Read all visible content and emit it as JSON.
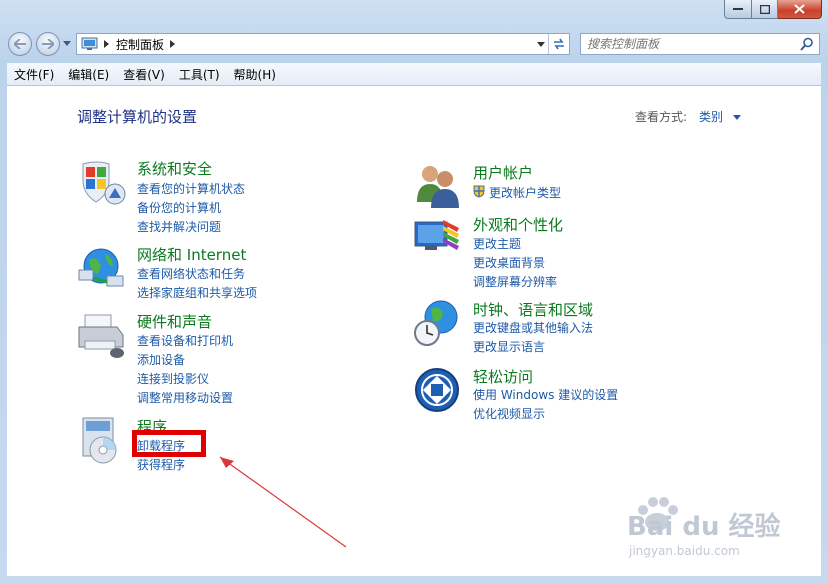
{
  "address": {
    "crumb": "控制面板"
  },
  "search": {
    "placeholder": "搜索控制面板"
  },
  "menu": [
    "文件(F)",
    "编辑(E)",
    "查看(V)",
    "工具(T)",
    "帮助(H)"
  ],
  "content": {
    "title": "调整计算机的设置",
    "view_by_label": "查看方式:",
    "view_by_value": "类别"
  },
  "left_categories": [
    {
      "title": "系统和安全",
      "links": [
        "查看您的计算机状态",
        "备份您的计算机",
        "查找并解决问题"
      ]
    },
    {
      "title": "网络和 Internet",
      "links": [
        "查看网络状态和任务",
        "选择家庭组和共享选项"
      ]
    },
    {
      "title": "硬件和声音",
      "links": [
        "查看设备和打印机",
        "添加设备",
        "连接到投影仪",
        "调整常用移动设置"
      ]
    },
    {
      "title": "程序",
      "links": [
        "卸载程序",
        "获得程序"
      ]
    }
  ],
  "right_categories": [
    {
      "title": "用户帐户",
      "links": [
        "更改帐户类型"
      ]
    },
    {
      "title": "外观和个性化",
      "links": [
        "更改主题",
        "更改桌面背景",
        "调整屏幕分辨率"
      ]
    },
    {
      "title": "时钟、语言和区域",
      "links": [
        "更改键盘或其他输入法",
        "更改显示语言"
      ]
    },
    {
      "title": "轻松访问",
      "links": [
        "使用 Windows 建议的设置",
        "优化视频显示"
      ]
    }
  ],
  "watermark": {
    "brand": "Bai du 经验",
    "site": "jingyan.baidu.com"
  },
  "colors": {
    "category": "#0a7a1e",
    "link": "#1e5aa8",
    "title": "#1e3287",
    "annotation": "#e00000"
  }
}
